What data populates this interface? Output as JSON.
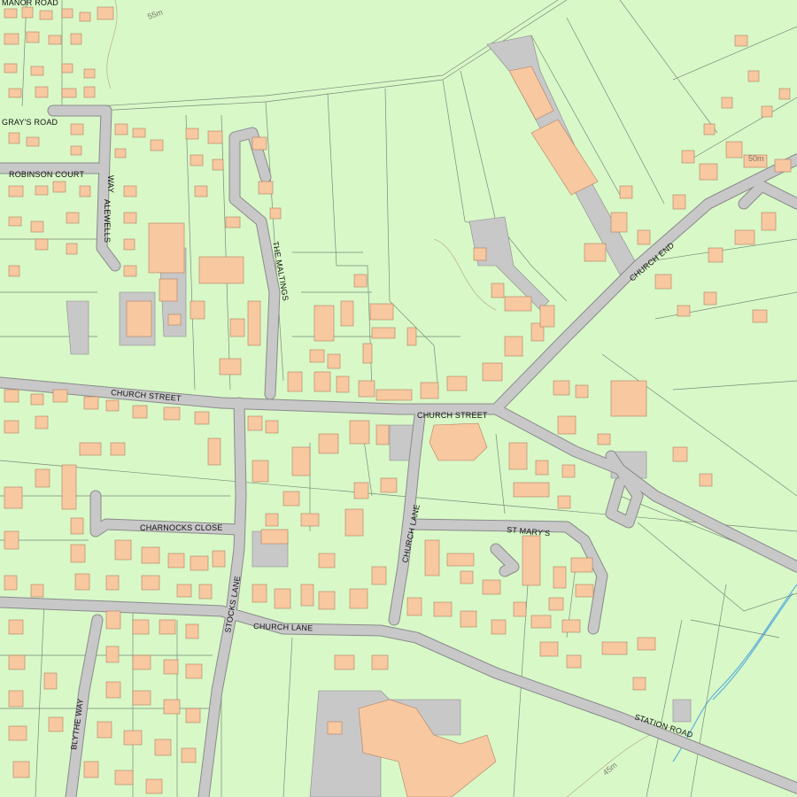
{
  "map": {
    "colors": {
      "land": "#d8f8c8",
      "building": "#f8c8a0",
      "road": "#c8c8c8",
      "road_edge": "#8a8a8a",
      "parcel_line": "#7a8a78",
      "water": "#60b0d8",
      "contour": "#b8b890"
    },
    "labels": {
      "manor_road": "MANOR ROAD",
      "grays_road": "GRAY'S ROAD",
      "robinson_court": "ROBINSON COURT",
      "way": "WAY",
      "alewells": "ALEWELLS",
      "the_maltings": "THE MALTINGS",
      "church_end": "CHURCH END",
      "church_street_w": "CHURCH STREET",
      "church_street_e": "CHURCH STREET",
      "church_lane_n": "CHURCH LANE",
      "church_lane_s": "CHURCH LANE",
      "charnocks_close": "CHARNOCKS CLOSE",
      "st_marys": "ST MARY'S",
      "stocks_lane": "STOCKS LANE",
      "blythe_way": "BLYTHE WAY",
      "station_road": "STATION ROAD"
    },
    "contours": {
      "c55": "55m",
      "c45": "45m",
      "c50": "50m"
    }
  }
}
